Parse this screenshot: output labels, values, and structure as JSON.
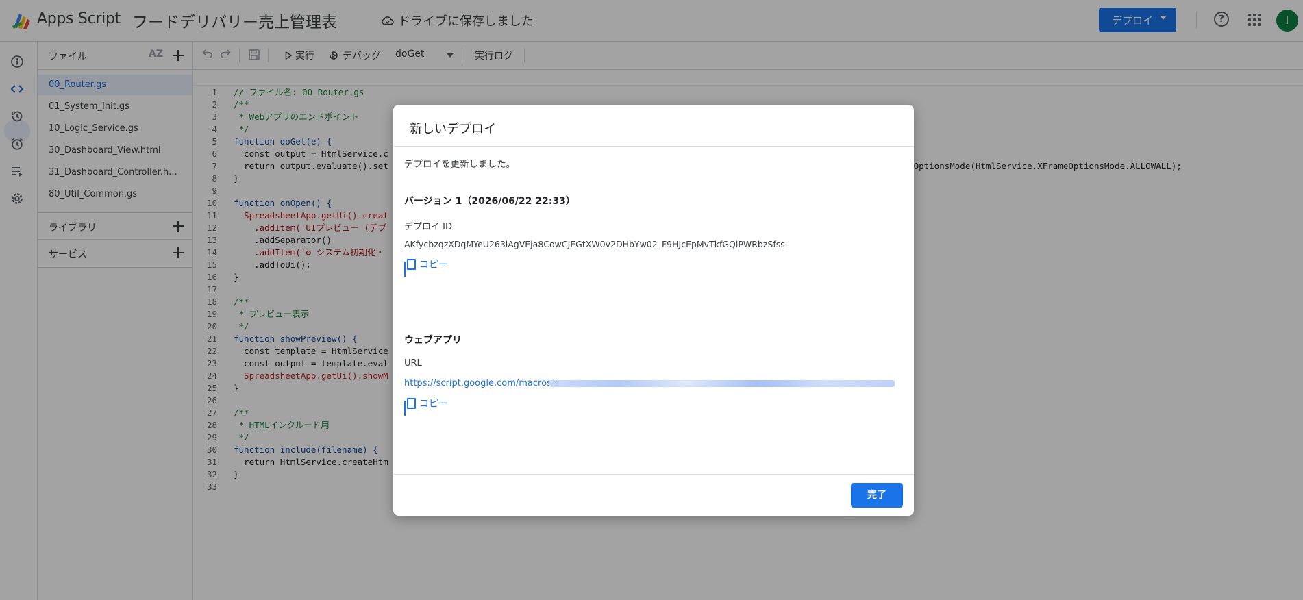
{
  "header": {
    "app_name": "Apps Script",
    "project_title": "フードデリバリー売上管理表",
    "save_status": "ドライブに保存しました",
    "deploy_label": "デプロイ",
    "avatar_initial": "I"
  },
  "files_panel": {
    "title": "ファイル",
    "sort_label": "AZ",
    "files": [
      "00_Router.gs",
      "01_System_Init.gs",
      "10_Logic_Service.gs",
      "30_Dashboard_View.html",
      "31_Dashboard_Controller.h...",
      "80_Util_Common.gs"
    ],
    "libraries_label": "ライブラリ",
    "services_label": "サービス"
  },
  "toolbar": {
    "run_label": "実行",
    "debug_label": "デバッグ",
    "function_name": "doGet",
    "log_label": "実行ログ"
  },
  "editor": {
    "line_numbers": [
      "1",
      "2",
      "3",
      "4",
      "5",
      "6",
      "7",
      "8",
      "9",
      "10",
      "11",
      "12",
      "13",
      "14",
      "15",
      "16",
      "17",
      "18",
      "19",
      "20",
      "21",
      "22",
      "23",
      "24",
      "25",
      "26",
      "27",
      "28",
      "29",
      "30",
      "31",
      "32",
      "33"
    ],
    "lines": [
      "// ファイル名: 00_Router.gs",
      "/**",
      " * Webアプリのエンドポイント",
      " */",
      "function doGet(e) {",
      "  const output = HtmlService.c",
      "  return output.evaluate().set",
      "}",
      "",
      "function onOpen() {",
      "  SpreadsheetApp.getUi().creat",
      "    .addItem('UIプレビュー (デブ",
      "    .addSeparator()",
      "    .addItem('⚙ システム初期化・",
      "    .addToUi();",
      "}",
      "",
      "/**",
      " * プレビュー表示",
      " */",
      "function showPreview() {",
      "  const template = HtmlService",
      "  const output = template.eval",
      "  SpreadsheetApp.getUi().showM",
      "}",
      "",
      "/**",
      " * HTMLインクルード用",
      " */",
      "function include(filename) {",
      "  return HtmlService.createHtm",
      "}",
      ""
    ],
    "line7_tail": "ameOptionsMode(HtmlService.XFrameOptionsMode.ALLOWALL);"
  },
  "dialog": {
    "title": "新しいデプロイ",
    "message": "デプロイを更新しました。",
    "version": "バージョン 1（2026/06/22 22:33）",
    "deploy_id_label": "デプロイ ID",
    "deploy_id": "AKfycbzqzXDqMYeU263iAgVEja8CowCJEGtXW0v2DHbYw02_F9HJcEpMvTkfGQiPWRbzSfss",
    "copy_label": "コピー",
    "webapp_label": "ウェブアプリ",
    "url_label": "URL",
    "url_visible": "https://script.google.com/macros/s",
    "done_label": "完了"
  },
  "colors": {
    "accent": "#1a73e8",
    "scrim": "rgba(0,0,0,0.36)"
  }
}
